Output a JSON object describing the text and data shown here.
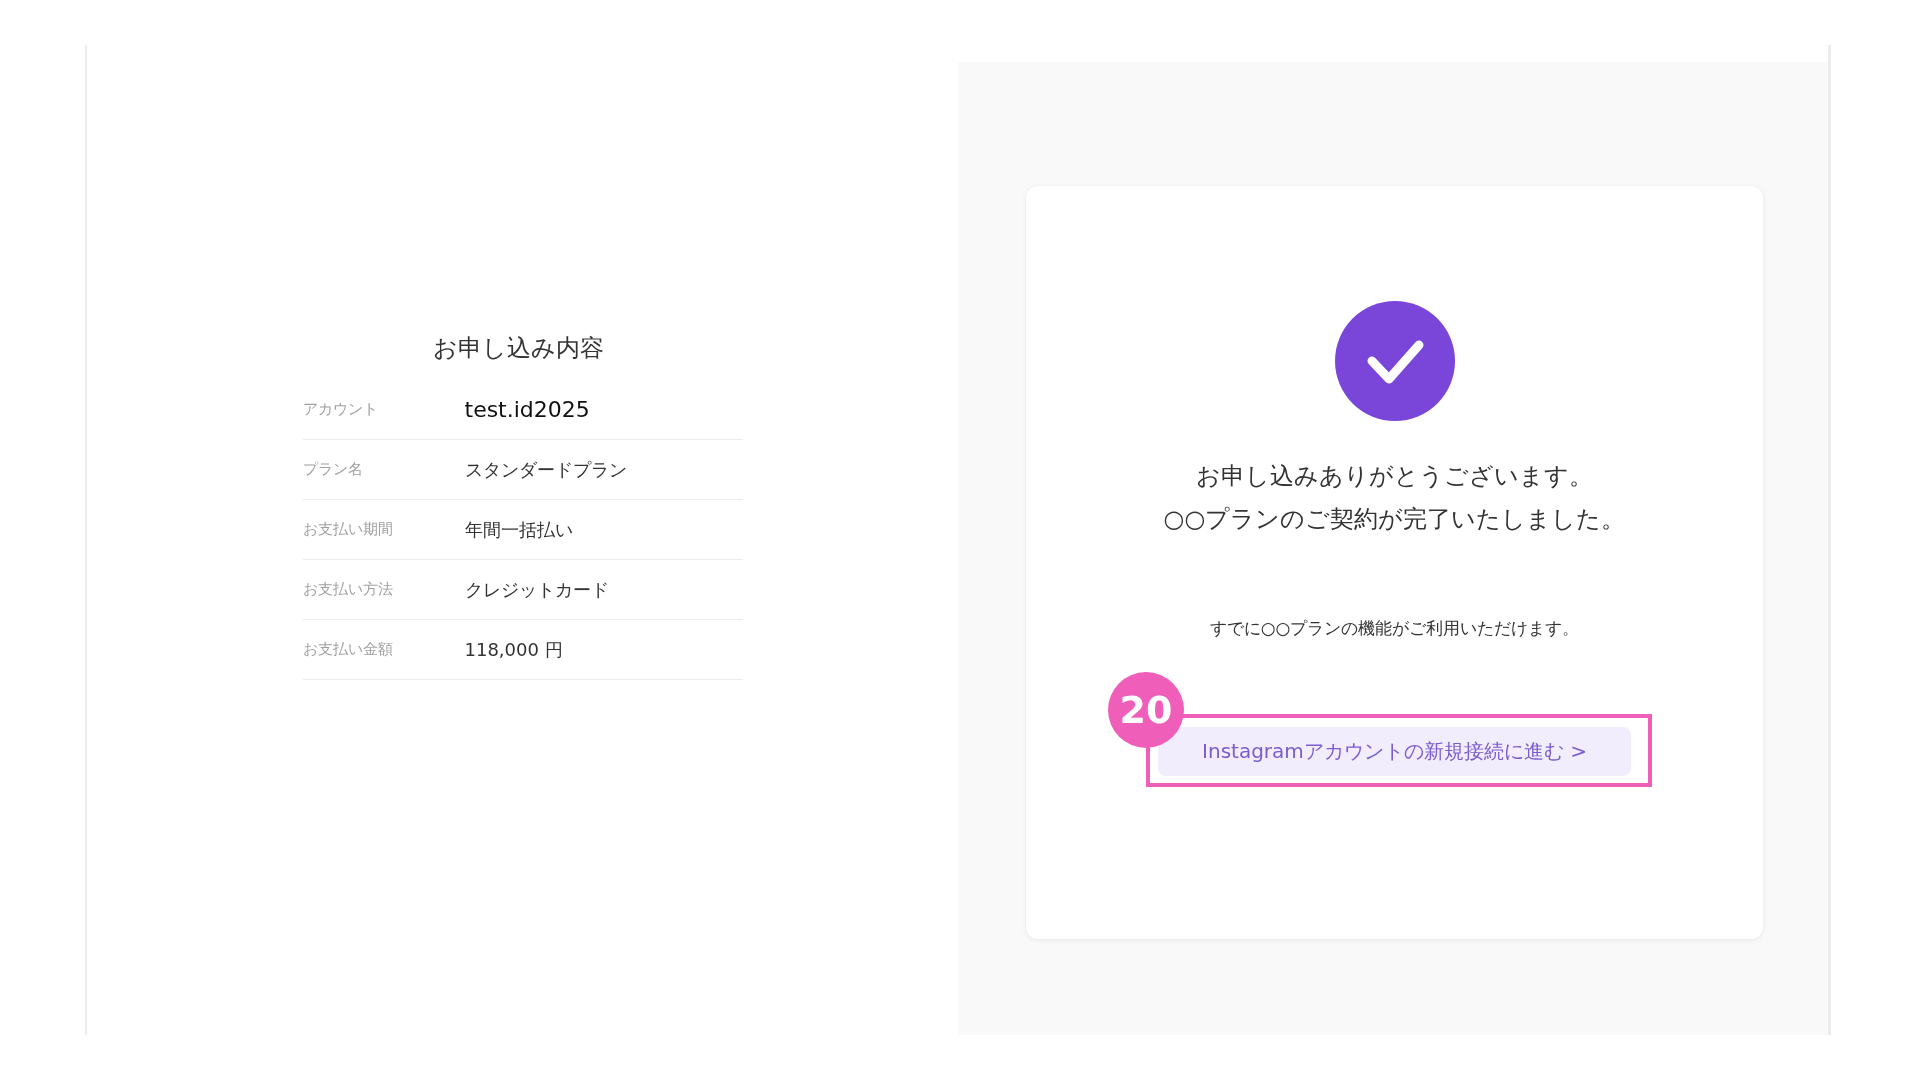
{
  "summary": {
    "title": "お申し込み内容",
    "rows": [
      {
        "kind": "account",
        "label": "アカウント",
        "value": "test.id2025"
      },
      {
        "kind": "plain",
        "label": "プラン名",
        "value": "スタンダードプラン"
      },
      {
        "kind": "plain",
        "label": "お支払い期間",
        "value": "年間一括払い"
      },
      {
        "kind": "plain",
        "label": "お支払い方法",
        "value": "クレジットカード"
      },
      {
        "kind": "plain",
        "label": "お支払い金額",
        "value": "118,000 円"
      }
    ]
  },
  "completion": {
    "message_lines": [
      "お申し込みありがとうございます。",
      "○○プランのご契約が完了いたしました。"
    ],
    "note": "すでに○○プランの機能がご利用いただけます。",
    "button": {
      "label": "Instagramアカウントの新規接続に進む >"
    }
  },
  "callout": {
    "number": "20"
  }
}
